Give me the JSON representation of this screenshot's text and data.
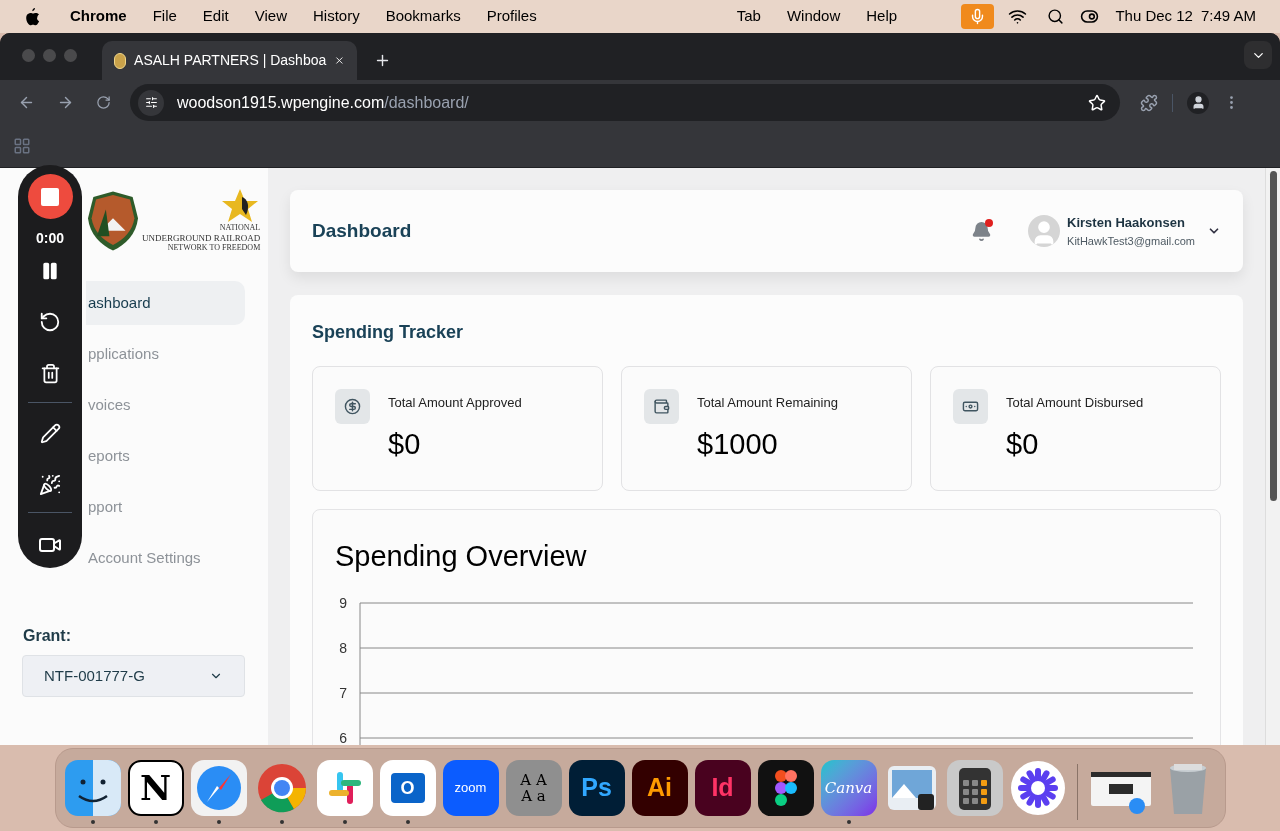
{
  "menubar": {
    "app": "Chrome",
    "items": [
      "File",
      "Edit",
      "View",
      "History",
      "Bookmarks",
      "Profiles",
      "Tab",
      "Window",
      "Help"
    ],
    "date": "Thu Dec 12",
    "time": "7:49 AM",
    "mic_active": true
  },
  "browser": {
    "tab": {
      "title": "ASALH PARTNERS | Dashboa",
      "selected": true
    },
    "url": {
      "host": "woodson1915.wpengine.com",
      "path": "/dashboard/"
    }
  },
  "recorder": {
    "time": "0:00"
  },
  "sidebar": {
    "logo_lines": [
      "NATIONAL",
      "UNDERGROUND RAILROAD",
      "NETWORK TO FREEDOM"
    ],
    "nav": [
      {
        "label": "ashboard",
        "selected": true
      },
      {
        "label": "pplications",
        "selected": false
      },
      {
        "label": "voices",
        "selected": false
      },
      {
        "label": "eports",
        "selected": false
      },
      {
        "label": "pport",
        "selected": false
      },
      {
        "label": "Account Settings",
        "selected": false
      }
    ],
    "grant_label": "Grant:",
    "grant_value": "NTF-001777-G"
  },
  "header": {
    "title": "Dashboard",
    "unread": true,
    "user": {
      "name": "Kirsten Haakonsen",
      "email": "KitHawkTest3@gmail.com"
    }
  },
  "tracker": {
    "title": "Spending Tracker",
    "stats": [
      {
        "kind": "dollar",
        "label": "Total Amount Approved",
        "value": "$0"
      },
      {
        "kind": "wallet",
        "label": "Total Amount Remaining",
        "value": "$1000"
      },
      {
        "kind": "cash",
        "label": "Total Amount Disbursed",
        "value": "$0"
      }
    ]
  },
  "overview": {
    "title": "Spending Overview",
    "axis_labels": [
      "9",
      "8",
      "7",
      "6"
    ]
  },
  "dock": [
    {
      "kind": "finder",
      "running": true
    },
    {
      "kind": "notion",
      "label": "N",
      "running": true
    },
    {
      "kind": "safari",
      "running": true
    },
    {
      "kind": "chrome",
      "running": true
    },
    {
      "kind": "slack",
      "running": true
    },
    {
      "kind": "outlook",
      "label": "O",
      "running": true
    },
    {
      "kind": "zoom",
      "label": "zoom",
      "running": false
    },
    {
      "kind": "fontbook",
      "label": "A A A a",
      "running": false
    },
    {
      "kind": "photoshop",
      "label": "Ps",
      "running": false
    },
    {
      "kind": "illustrator",
      "label": "Ai",
      "running": false
    },
    {
      "kind": "indesign",
      "label": "Id",
      "running": false
    },
    {
      "kind": "figma",
      "running": false
    },
    {
      "kind": "canva",
      "label": "Canva",
      "running": true
    },
    {
      "kind": "preview",
      "running": false
    },
    {
      "kind": "calculator",
      "running": false
    },
    {
      "kind": "asterisk",
      "running": false
    },
    {
      "kind": "divider"
    },
    {
      "kind": "window",
      "running": false
    },
    {
      "kind": "trash",
      "running": false
    }
  ]
}
